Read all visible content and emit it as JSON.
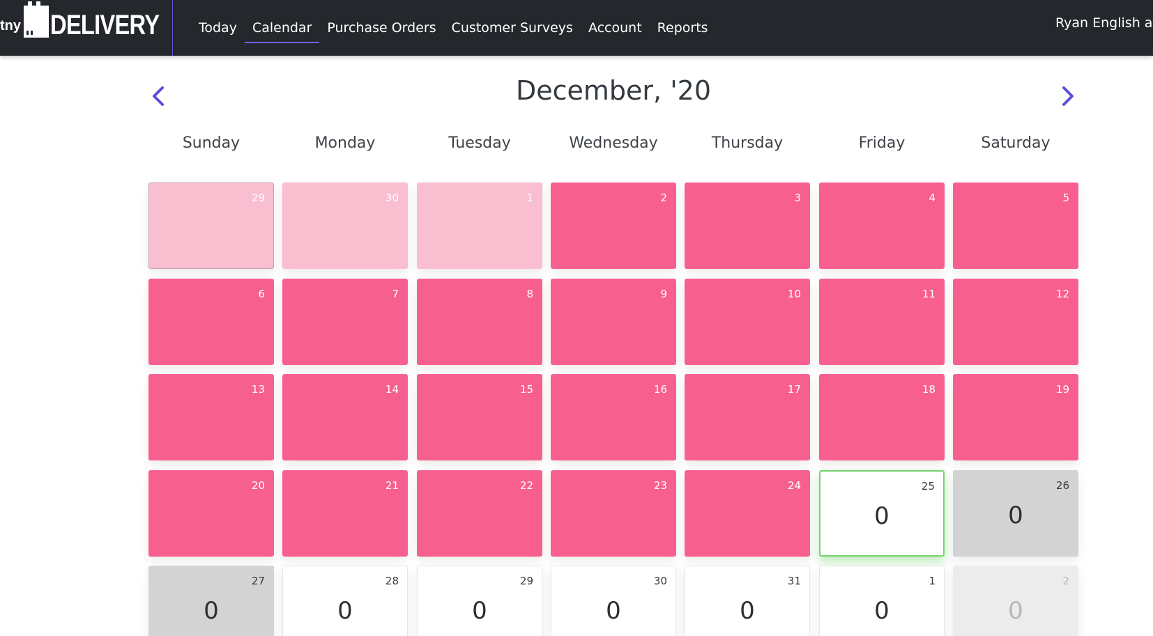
{
  "navbar": {
    "brand_prefix": "tny",
    "brand_name": "DELIVERY",
    "items": [
      {
        "label": "Today",
        "active": false
      },
      {
        "label": "Calendar",
        "active": true
      },
      {
        "label": "Purchase Orders",
        "active": false
      },
      {
        "label": "Customer Surveys",
        "active": false
      },
      {
        "label": "Account",
        "active": false
      },
      {
        "label": "Reports",
        "active": false
      }
    ],
    "user_label": "Ryan English at"
  },
  "calendar": {
    "title": "December, '20",
    "prev_icon": "chevron-left-icon",
    "next_icon": "chevron-right-icon",
    "days_of_week": [
      "Sunday",
      "Monday",
      "Tuesday",
      "Wednesday",
      "Thursday",
      "Friday",
      "Saturday"
    ],
    "colors": {
      "past": "#f7608e",
      "out_of_month_past": "#f9bed0",
      "today_border": "#76d36e",
      "weekend": "#d3d3d3",
      "accent": "#5b4fd6"
    },
    "weeks": [
      [
        {
          "day": "29",
          "state": "outpast"
        },
        {
          "day": "30",
          "state": "outpast"
        },
        {
          "day": "1",
          "state": "outpast"
        },
        {
          "day": "2",
          "state": "past"
        },
        {
          "day": "3",
          "state": "past"
        },
        {
          "day": "4",
          "state": "past"
        },
        {
          "day": "5",
          "state": "past"
        }
      ],
      [
        {
          "day": "6",
          "state": "past"
        },
        {
          "day": "7",
          "state": "past"
        },
        {
          "day": "8",
          "state": "past"
        },
        {
          "day": "9",
          "state": "past"
        },
        {
          "day": "10",
          "state": "past"
        },
        {
          "day": "11",
          "state": "past"
        },
        {
          "day": "12",
          "state": "past"
        }
      ],
      [
        {
          "day": "13",
          "state": "past"
        },
        {
          "day": "14",
          "state": "past"
        },
        {
          "day": "15",
          "state": "past"
        },
        {
          "day": "16",
          "state": "past"
        },
        {
          "day": "17",
          "state": "past"
        },
        {
          "day": "18",
          "state": "past"
        },
        {
          "day": "19",
          "state": "past"
        }
      ],
      [
        {
          "day": "20",
          "state": "past"
        },
        {
          "day": "21",
          "state": "past"
        },
        {
          "day": "22",
          "state": "past"
        },
        {
          "day": "23",
          "state": "past"
        },
        {
          "day": "24",
          "state": "past"
        },
        {
          "day": "25",
          "state": "today",
          "count": "0"
        },
        {
          "day": "26",
          "state": "weekend",
          "count": "0"
        }
      ],
      [
        {
          "day": "27",
          "state": "weekend",
          "count": "0"
        },
        {
          "day": "28",
          "state": "weekday",
          "count": "0"
        },
        {
          "day": "29",
          "state": "weekday",
          "count": "0"
        },
        {
          "day": "30",
          "state": "weekday",
          "count": "0"
        },
        {
          "day": "31",
          "state": "weekday",
          "count": "0"
        },
        {
          "day": "1",
          "state": "weekday",
          "count": "0"
        },
        {
          "day": "2",
          "state": "outfuture",
          "count": "0"
        }
      ]
    ]
  }
}
